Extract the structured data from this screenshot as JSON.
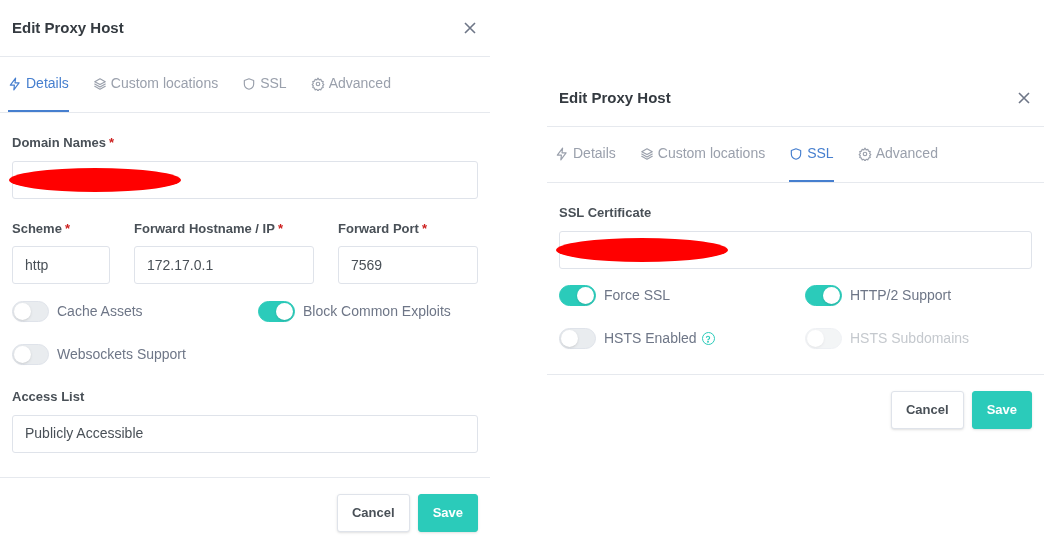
{
  "dialogs": [
    {
      "title": "Edit Proxy Host",
      "tabs": [
        {
          "label": "Details",
          "selected": true
        },
        {
          "label": "Custom locations",
          "selected": false
        },
        {
          "label": "SSL",
          "selected": false
        },
        {
          "label": "Advanced",
          "selected": false
        }
      ],
      "body": [
        {
          "kind": "field",
          "label": "Domain Names",
          "required_mark": "*",
          "redacted": true
        },
        {
          "kind": "field_row",
          "fields": [
            {
              "label": "Scheme",
              "required_mark": "*",
              "value": "http"
            },
            {
              "label": "Forward Hostname / IP",
              "required_mark": "*",
              "value": "172.17.0.1"
            },
            {
              "label": "Forward Port",
              "required_mark": "*",
              "value": "7569"
            }
          ]
        },
        {
          "kind": "toggles",
          "items": [
            {
              "label": "Cache Assets",
              "on": false
            },
            {
              "label": "Block Common Exploits",
              "on": true
            },
            {
              "label": "Websockets Support",
              "on": false
            }
          ]
        },
        {
          "kind": "field",
          "label": "Access List",
          "value": "Publicly Accessible"
        }
      ],
      "buttons": [
        {
          "label": "Cancel",
          "kind": "secondary"
        },
        {
          "label": "Save",
          "kind": "primary"
        }
      ]
    },
    {
      "title": "Edit Proxy Host",
      "tabs": [
        {
          "label": "Details",
          "selected": false
        },
        {
          "label": "Custom locations",
          "selected": false
        },
        {
          "label": "SSL",
          "selected": true
        },
        {
          "label": "Advanced",
          "selected": false
        }
      ],
      "body": [
        {
          "kind": "field",
          "label": "SSL Certificate",
          "redacted": true
        },
        {
          "kind": "toggles",
          "items": [
            {
              "label": "Force SSL",
              "on": true
            },
            {
              "label": "HTTP/2 Support",
              "on": true
            },
            {
              "label": "HSTS Enabled",
              "on": false,
              "help": true
            },
            {
              "label": "HSTS Subdomains",
              "on": false,
              "disabled": true
            }
          ]
        }
      ],
      "buttons": [
        {
          "label": "Cancel",
          "kind": "secondary"
        },
        {
          "label": "Save",
          "kind": "primary"
        }
      ]
    }
  ]
}
